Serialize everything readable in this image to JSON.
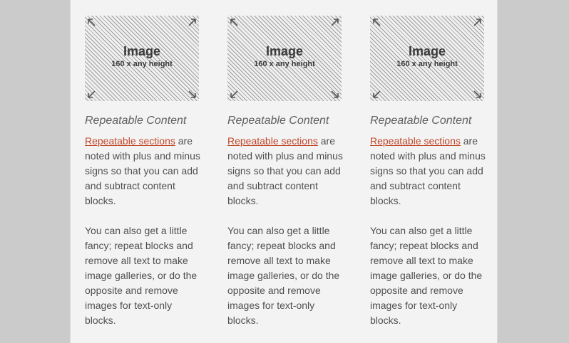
{
  "columns": [
    {
      "image_title": "Image",
      "image_subtitle": "160 x any height",
      "heading": "Repeatable Content",
      "link_text": "Repeatable sections",
      "para1_rest": " are noted with plus and minus signs so that you can add and subtract content blocks.",
      "para2": "You can also get a little fancy; repeat blocks and remove all text to make image galleries, or do the opposite and remove images for text-only blocks."
    },
    {
      "image_title": "Image",
      "image_subtitle": "160 x any height",
      "heading": "Repeatable Content",
      "link_text": "Repeatable sections",
      "para1_rest": " are noted with plus and minus signs so that you can add and subtract content blocks.",
      "para2": "You can also get a little fancy; repeat blocks and remove all text to make image galleries, or do the opposite and remove images for text-only blocks."
    },
    {
      "image_title": "Image",
      "image_subtitle": "160 x any height",
      "heading": "Repeatable Content",
      "link_text": "Repeatable sections",
      "para1_rest": " are noted with plus and minus signs so that you can add and subtract content blocks.",
      "para2": "You can also get a little fancy; repeat blocks and remove all text to make image galleries, or do the opposite and remove images for text-only blocks."
    }
  ],
  "colors": {
    "page_background": "#cbcbcb",
    "panel_background": "#f3f3f3",
    "link": "#c0472a",
    "body_text": "#505050",
    "heading_text": "#606060"
  },
  "icons": {
    "corner_arrows": [
      "arrow-up-left-icon",
      "arrow-up-right-icon",
      "arrow-down-left-icon",
      "arrow-down-right-icon"
    ]
  }
}
